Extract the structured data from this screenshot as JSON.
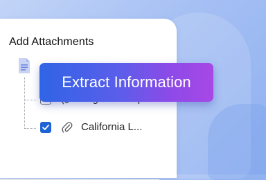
{
  "panel": {
    "title": "Add Attachments"
  },
  "tree": {
    "root_icon": "document-icon",
    "files": [
      {
        "name": "Legal rules .pdf",
        "checked": false,
        "icon": "paperclip-icon"
      },
      {
        "name": "California L...",
        "checked": true,
        "icon": "paperclip-icon"
      }
    ]
  },
  "action": {
    "extract_label": "Extract Information"
  },
  "colors": {
    "accent": "#1e63d6",
    "button_gradient_start": "#2f64e6",
    "button_gradient_end": "#a848e6",
    "background": "#a6c0f4"
  }
}
